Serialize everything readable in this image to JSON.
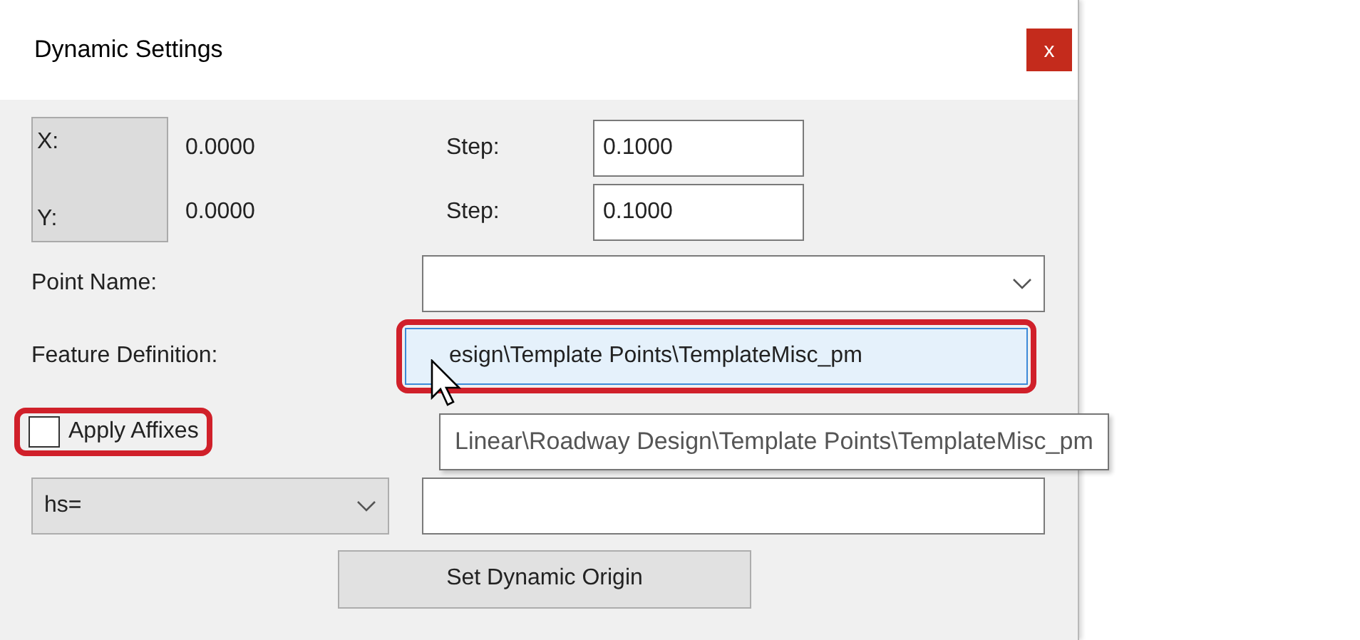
{
  "window": {
    "title": "Dynamic Settings",
    "close_button": "x"
  },
  "coordinates": [
    {
      "label": "X:",
      "value": "0.0000",
      "step_label": "Step:",
      "step": "0.1000"
    },
    {
      "label": "Y:",
      "value": "0.0000",
      "step_label": "Step:",
      "step": "0.1000"
    }
  ],
  "point_name": {
    "label": "Point Name:"
  },
  "feature_definition": {
    "label": "Feature Definition:",
    "value": "esign\\Template Points\\TemplateMisc_pm",
    "highlighted": true,
    "tooltip": "Linear\\Roadway Design\\Template Points\\TemplateMisc_pm"
  },
  "apply_affixes": {
    "label": "Apply Affixes",
    "checked": false,
    "highlighted": true
  },
  "affix": {
    "selected_option": "hs="
  },
  "buttons": [
    "Set Dynamic Origin"
  ]
}
